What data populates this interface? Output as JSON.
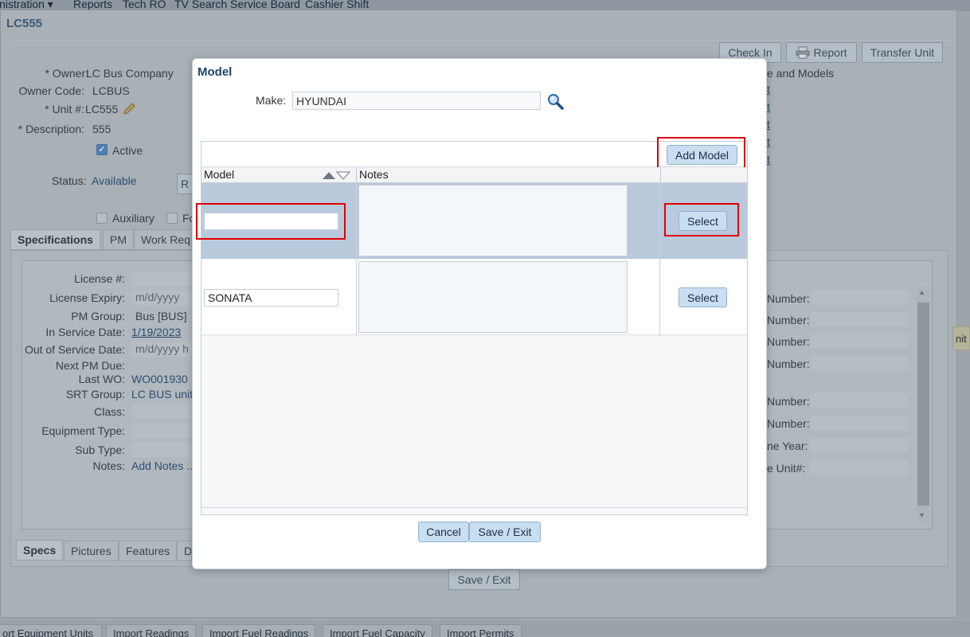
{
  "top_menu": {
    "items": [
      "inistration ▾",
      "Reports",
      "Tech RO",
      "TV Search Service Board",
      "Cashier Shift"
    ]
  },
  "background": {
    "window_title": "LC555",
    "buttons": {
      "check_in": "Check In",
      "report": "Report",
      "transfer_unit": "Transfer Unit"
    },
    "owner_label": "* Owner:",
    "owner_value": "LC Bus Company",
    "owner_code_label": "Owner Code:",
    "owner_code_value": "LCBUS",
    "unit_label": "* Unit #:",
    "unit_value": "LC555",
    "description_label": "* Description:",
    "description_value": "555",
    "active_label": "Active",
    "status_label": "Status:",
    "status_value": "Available",
    "auxiliary_label": "Auxiliary",
    "partial_fo": "Fo",
    "make_models_text": "e and Models",
    "t_links": [
      "t",
      "t",
      "t",
      "t",
      "t"
    ],
    "tabs": [
      "Specifications",
      "PM",
      "Work Requ"
    ],
    "fields": {
      "license_label": "License #:",
      "license_expiry_label": "License Expiry:",
      "license_expiry_placeholder": "m/d/yyyy",
      "pm_group_label": "PM Group:",
      "pm_group_value": "Bus [BUS]",
      "in_service_label": "In Service Date:",
      "in_service_value": "1/19/2023",
      "out_service_label": "Out of Service Date:",
      "out_service_placeholder": "m/d/yyyy h",
      "next_pm_label": "Next PM Due:",
      "last_wo_label": "Last WO:",
      "last_wo_value": "WO001930",
      "srt_label": "SRT Group:",
      "srt_value": "LC BUS units",
      "class_label": "Class:",
      "equip_type_label": "Equipment Type:",
      "sub_type_label": "Sub Type:",
      "notes_label": "Notes:",
      "notes_link": "Add Notes .."
    },
    "right_labels": [
      "Number:",
      "Number:",
      "Number:",
      "Number:",
      "Number:",
      "Number:",
      "ne Year:",
      "e Unit#:"
    ],
    "right_partial": "nit",
    "bottom_tabs": [
      "Specs",
      "Pictures",
      "Features",
      "D"
    ],
    "save_exit": "Save / Exit"
  },
  "bottom_bar": {
    "tabs": [
      "ort Equipment Units",
      "Import Readings",
      "Import Fuel Readings",
      "Import Fuel Capacity",
      "Import Permits"
    ]
  },
  "modal": {
    "title": "Model",
    "make_label": "Make:",
    "make_value": "HYUNDAI",
    "add_model_label": "Add Model",
    "columns": {
      "model": "Model",
      "notes": "Notes"
    },
    "rows": [
      {
        "model": "",
        "notes": "",
        "select_label": "Select",
        "selected": true
      },
      {
        "model": "SONATA",
        "notes": "",
        "select_label": "Select",
        "selected": false
      }
    ],
    "cancel_label": "Cancel",
    "save_exit_label": "Save / Exit"
  },
  "colors": {
    "highlight": "#e00000",
    "selected_row": "#b8c9dc",
    "button_bg": "#c9def1",
    "title_color": "#1d4566"
  }
}
